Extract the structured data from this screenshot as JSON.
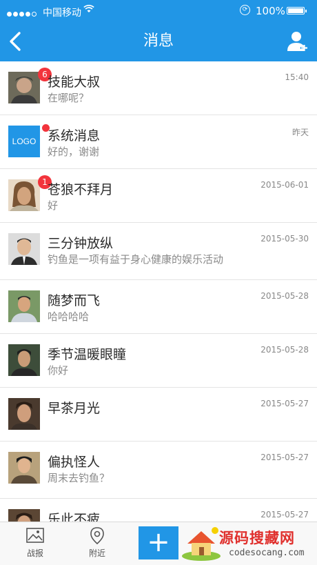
{
  "status": {
    "carrier": "中国移动",
    "battery": "100%"
  },
  "header": {
    "title": "消息"
  },
  "messages": [
    {
      "name": "技能大叔",
      "preview": "在哪呢？",
      "time": "15:40",
      "badge": "6"
    },
    {
      "name": "系统消息",
      "preview": "好的，谢谢",
      "time": "昨天",
      "badge": "",
      "logo_text": "LOGO"
    },
    {
      "name": "苍狼不拜月",
      "preview": "好",
      "time": "2015-06-01",
      "badge": "1"
    },
    {
      "name": "三分钟放纵",
      "preview": "钓鱼是一项有益于身心健康的娱乐活动",
      "time": "2015-05-30",
      "badge": ""
    },
    {
      "name": "随梦而飞",
      "preview": "哈哈哈哈",
      "time": "2015-05-28",
      "badge": ""
    },
    {
      "name": "季节温暖眼瞳",
      "preview": "你好",
      "time": "2015-05-28",
      "badge": ""
    },
    {
      "name": "早茶月光",
      "preview": "",
      "time": "2015-05-27",
      "badge": ""
    },
    {
      "name": "偏执怪人",
      "preview": "周末去钓鱼？",
      "time": "2015-05-27",
      "badge": ""
    },
    {
      "name": "乐此不疲",
      "preview": "",
      "time": "2015-05-27",
      "badge": ""
    }
  ],
  "tabbar": {
    "tab1": "战报",
    "tab2": "附近",
    "plus": "+"
  },
  "watermark": {
    "brand": "源码搜藏网",
    "url": "codesocang.com"
  },
  "colors": {
    "primary": "#2196e6",
    "badge": "#f2343c"
  }
}
